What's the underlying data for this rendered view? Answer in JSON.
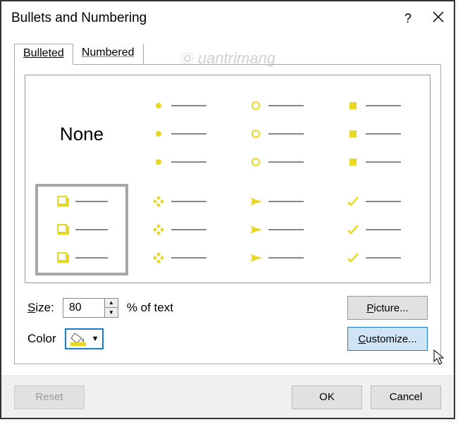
{
  "title": "Bullets and Numbering",
  "help_glyph": "?",
  "tabs": {
    "bulleted": "Bulleted",
    "numbered": "Numbered"
  },
  "grid": {
    "none_label": "None",
    "options": [
      {
        "id": "none",
        "glyph": "none"
      },
      {
        "id": "filled-circle",
        "glyph": "disc"
      },
      {
        "id": "open-circle",
        "glyph": "ring"
      },
      {
        "id": "filled-square",
        "glyph": "square"
      },
      {
        "id": "box3d",
        "glyph": "box3d",
        "selected": true
      },
      {
        "id": "four-diamond",
        "glyph": "four-diamond"
      },
      {
        "id": "arrowhead",
        "glyph": "arrowhead"
      },
      {
        "id": "checkmark",
        "glyph": "check"
      }
    ]
  },
  "size": {
    "label_prefix": "S",
    "label_rest": "ize:",
    "value": "80",
    "pct_text": "% of text"
  },
  "color": {
    "label_prefix": "C",
    "label_rest": "olor",
    "value": "#e8d821"
  },
  "buttons": {
    "picture_prefix": "P",
    "picture_rest": "icture...",
    "customize_prefix": "C",
    "customize_rest": "ustomize...",
    "reset_prefix": "R",
    "reset_rest": "eset",
    "ok": "OK",
    "cancel": "Cancel"
  },
  "watermark": "uantrimang"
}
